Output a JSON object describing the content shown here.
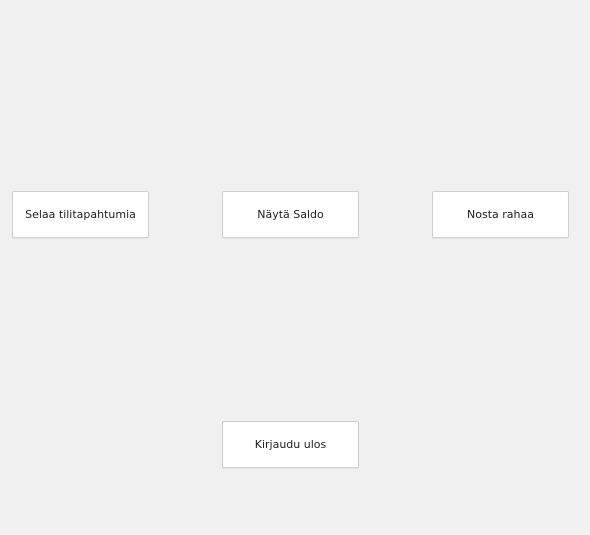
{
  "menu": {
    "browse_transactions_label": "Selaa tilitapahtumia",
    "show_balance_label": "Näytä Saldo",
    "withdraw_label": "Nosta rahaa",
    "logout_label": "Kirjaudu ulos"
  },
  "colors": {
    "background": "#f0f0f0",
    "button_bg": "#ffffff",
    "button_border": "#d0d0d0",
    "text": "#1e1e1e"
  }
}
